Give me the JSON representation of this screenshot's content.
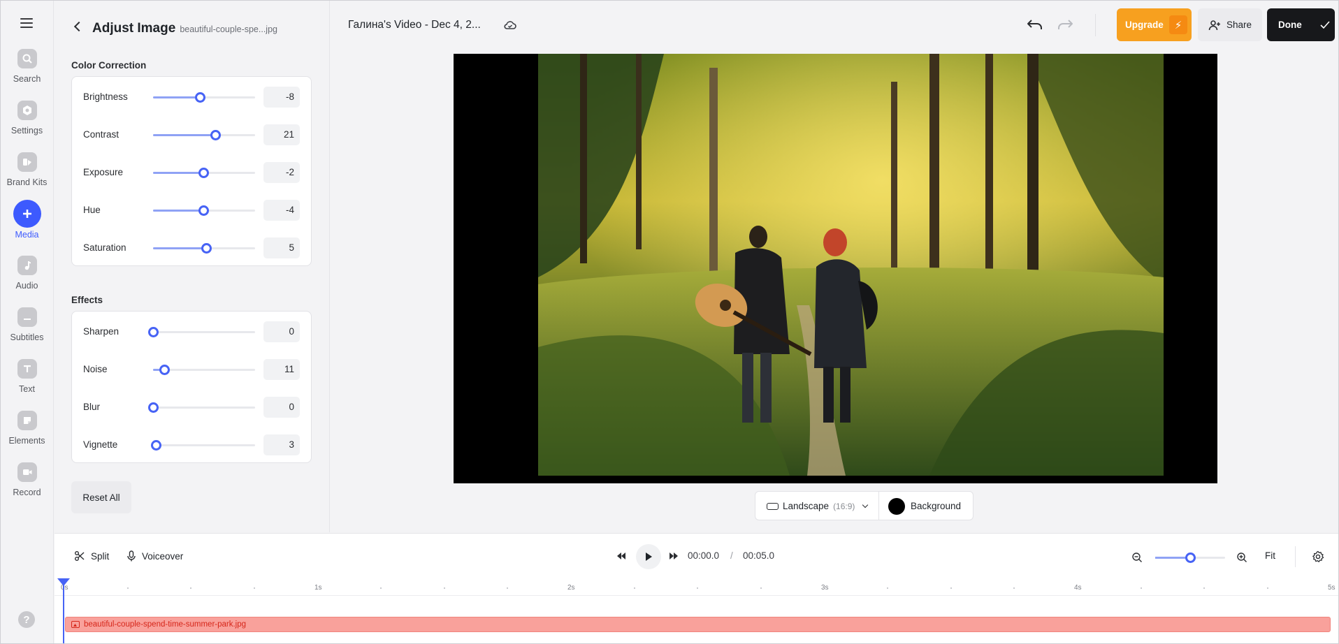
{
  "rail": {
    "items": [
      {
        "label": "Search",
        "icon": "search-icon"
      },
      {
        "label": "Settings",
        "icon": "settings-icon"
      },
      {
        "label": "Brand Kits",
        "icon": "brand-kits-icon"
      },
      {
        "label": "Media",
        "icon": "plus-icon",
        "active": true
      },
      {
        "label": "Audio",
        "icon": "music-note-icon"
      },
      {
        "label": "Subtitles",
        "icon": "subtitles-icon"
      },
      {
        "label": "Text",
        "icon": "text-icon"
      },
      {
        "label": "Elements",
        "icon": "elements-icon"
      },
      {
        "label": "Record",
        "icon": "camera-icon"
      }
    ],
    "help_glyph": "?"
  },
  "panel": {
    "title": "Adjust Image",
    "file_name": "beautiful-couple-spe...jpg",
    "color_correction": {
      "title": "Color Correction",
      "rows": [
        {
          "label": "Brightness",
          "value": "-8",
          "level": 0.46
        },
        {
          "label": "Contrast",
          "value": "21",
          "level": 0.61
        },
        {
          "label": "Exposure",
          "value": "-2",
          "level": 0.49
        },
        {
          "label": "Hue",
          "value": "-4",
          "level": 0.49
        },
        {
          "label": "Saturation",
          "value": "5",
          "level": 0.52
        }
      ]
    },
    "effects": {
      "title": "Effects",
      "rows": [
        {
          "label": "Sharpen",
          "value": "0",
          "level": 0.0
        },
        {
          "label": "Noise",
          "value": "11",
          "level": 0.11
        },
        {
          "label": "Blur",
          "value": "0",
          "level": 0.0
        },
        {
          "label": "Vignette",
          "value": "3",
          "level": 0.03
        }
      ]
    },
    "reset_label": "Reset All"
  },
  "topbar": {
    "project_title": "Галина's Video - Dec 4, 2...",
    "upgrade_label": "Upgrade",
    "upgrade_icon": "⚡",
    "share_label": "Share",
    "done_label": "Done"
  },
  "canvas_controls": {
    "aspect_label": "Landscape",
    "aspect_ratio": "(16:9)",
    "background_label": "Background",
    "background_color": "#000000"
  },
  "timeline": {
    "split_label": "Split",
    "voiceover_label": "Voiceover",
    "current_time": "00:00.0",
    "time_separator": "/",
    "total_time": "00:05.0",
    "fit_label": "Fit",
    "zoom_level": 0.5,
    "ticks": [
      "0s",
      "1s",
      "2s",
      "3s",
      "4s",
      "5s"
    ],
    "clip_name": "beautiful-couple-spend-time-summer-park.jpg"
  },
  "colors": {
    "accent": "#3d5afe",
    "upgrade": "#f7a01f",
    "done": "#17181b",
    "clip": "#f9a19b"
  }
}
